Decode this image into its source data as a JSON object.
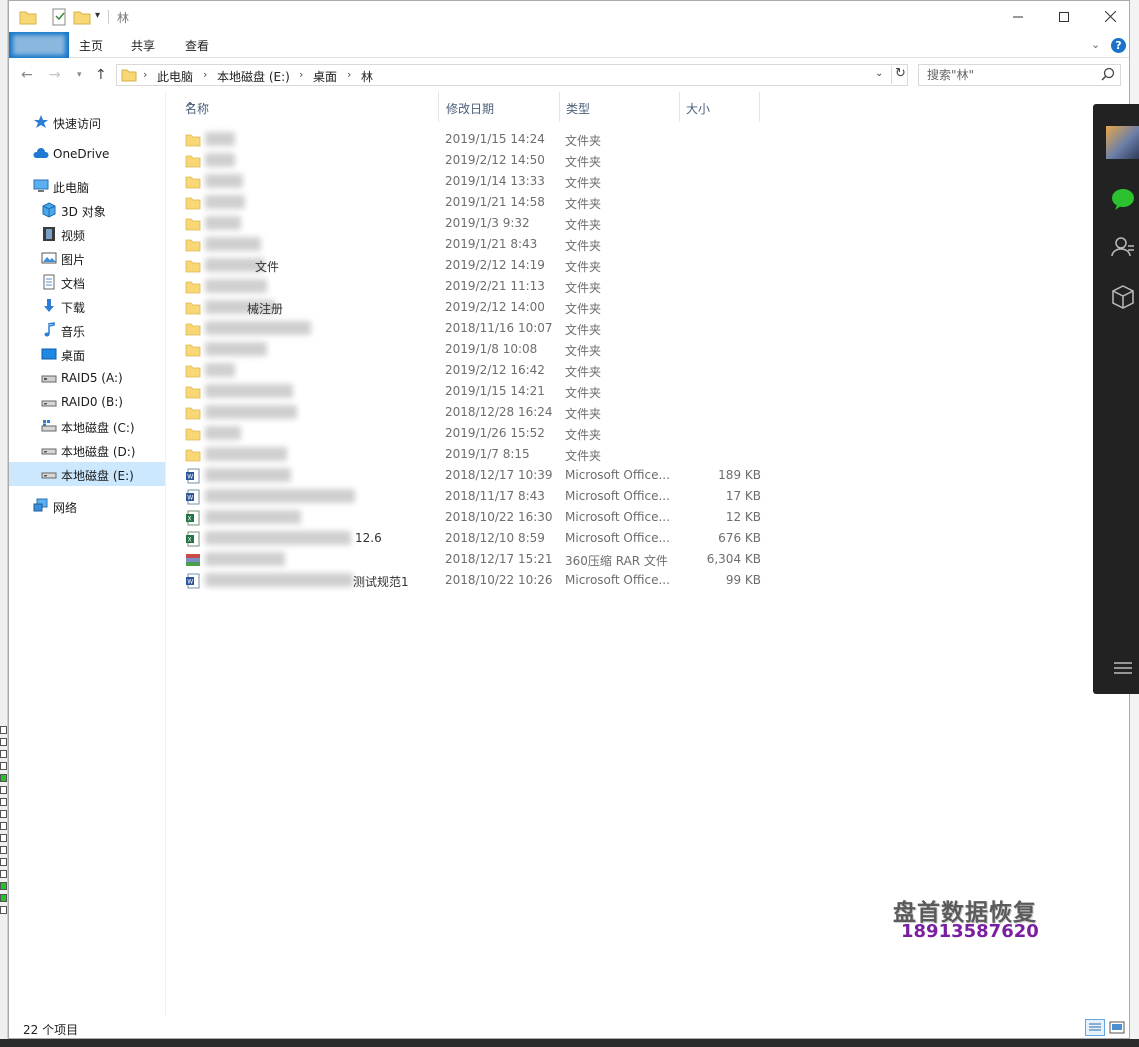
{
  "window": {
    "title": "林",
    "minimize_icon": "minimize-icon",
    "maximize_icon": "maximize-icon",
    "close_icon": "close-icon"
  },
  "ribbon": {
    "tabs": [
      "主页",
      "共享",
      "查看"
    ],
    "help_label": "?"
  },
  "navbar": {
    "breadcrumb": [
      "此电脑",
      "本地磁盘 (E:)",
      "桌面",
      "林"
    ],
    "search_placeholder": "搜索\"林\""
  },
  "navpane": {
    "items": [
      {
        "label": "快速访问",
        "icon": "star-icon"
      },
      {
        "label": "OneDrive",
        "icon": "cloud-icon"
      },
      {
        "label": "此电脑",
        "icon": "computer-icon"
      },
      {
        "label": "3D 对象",
        "icon": "cube-icon"
      },
      {
        "label": "视频",
        "icon": "film-icon"
      },
      {
        "label": "图片",
        "icon": "picture-icon"
      },
      {
        "label": "文档",
        "icon": "document-icon"
      },
      {
        "label": "下载",
        "icon": "download-icon"
      },
      {
        "label": "音乐",
        "icon": "music-icon"
      },
      {
        "label": "桌面",
        "icon": "desktop-icon"
      },
      {
        "label": "RAID5 (A:)",
        "icon": "drive-icon"
      },
      {
        "label": "RAID0 (B:)",
        "icon": "drive-icon"
      },
      {
        "label": "本地磁盘 (C:)",
        "icon": "windows-drive-icon"
      },
      {
        "label": "本地磁盘 (D:)",
        "icon": "drive-icon"
      },
      {
        "label": "本地磁盘 (E:)",
        "icon": "drive-icon"
      },
      {
        "label": "网络",
        "icon": "network-icon"
      }
    ]
  },
  "columns": [
    "名称",
    "修改日期",
    "类型",
    "大小"
  ],
  "files": [
    {
      "name": "",
      "date": "2019/1/15 14:24",
      "type": "文件夹",
      "size": "",
      "icon": "folder-icon"
    },
    {
      "name": "",
      "date": "2019/2/12 14:50",
      "type": "文件夹",
      "size": "",
      "icon": "folder-icon"
    },
    {
      "name": "",
      "date": "2019/1/14 13:33",
      "type": "文件夹",
      "size": "",
      "icon": "folder-icon"
    },
    {
      "name": "",
      "date": "2019/1/21 14:58",
      "type": "文件夹",
      "size": "",
      "icon": "folder-icon"
    },
    {
      "name": "",
      "date": "2019/1/3 9:32",
      "type": "文件夹",
      "size": "",
      "icon": "folder-icon"
    },
    {
      "name": "",
      "date": "2019/1/21 8:43",
      "type": "文件夹",
      "size": "",
      "icon": "folder-icon"
    },
    {
      "name": "文件",
      "date": "2019/2/12 14:19",
      "type": "文件夹",
      "size": "",
      "icon": "folder-icon"
    },
    {
      "name": "",
      "date": "2019/2/21 11:13",
      "type": "文件夹",
      "size": "",
      "icon": "folder-icon"
    },
    {
      "name": "械注册",
      "date": "2019/2/12 14:00",
      "type": "文件夹",
      "size": "",
      "icon": "folder-icon"
    },
    {
      "name": "",
      "date": "2018/11/16 10:07",
      "type": "文件夹",
      "size": "",
      "icon": "folder-icon"
    },
    {
      "name": "",
      "date": "2019/1/8 10:08",
      "type": "文件夹",
      "size": "",
      "icon": "folder-icon"
    },
    {
      "name": "",
      "date": "2019/2/12 16:42",
      "type": "文件夹",
      "size": "",
      "icon": "folder-icon"
    },
    {
      "name": "",
      "date": "2019/1/15 14:21",
      "type": "文件夹",
      "size": "",
      "icon": "folder-icon"
    },
    {
      "name": "",
      "date": "2018/12/28 16:24",
      "type": "文件夹",
      "size": "",
      "icon": "folder-icon"
    },
    {
      "name": "",
      "date": "2019/1/26 15:52",
      "type": "文件夹",
      "size": "",
      "icon": "folder-icon"
    },
    {
      "name": "",
      "date": "2019/1/7 8:15",
      "type": "文件夹",
      "size": "",
      "icon": "folder-icon"
    },
    {
      "name": "",
      "date": "2018/12/17 10:39",
      "type": "Microsoft Office...",
      "size": "189 KB",
      "icon": "word-doc-icon"
    },
    {
      "name": "",
      "date": "2018/11/17 8:43",
      "type": "Microsoft Office...",
      "size": "17 KB",
      "icon": "word-doc-icon"
    },
    {
      "name": "",
      "date": "2018/10/22 16:30",
      "type": "Microsoft Office...",
      "size": "12 KB",
      "icon": "excel-doc-icon"
    },
    {
      "name": "12.6",
      "date": "2018/12/10 8:59",
      "type": "Microsoft Office...",
      "size": "676 KB",
      "icon": "excel-doc-icon"
    },
    {
      "name": "",
      "date": "2018/12/17 15:21",
      "type": "360压缩 RAR 文件",
      "size": "6,304 KB",
      "icon": "rar-archive-icon"
    },
    {
      "name": "测试规范1",
      "date": "2018/10/22 10:26",
      "type": "Microsoft Office...",
      "size": "99 KB",
      "icon": "word-doc-icon"
    }
  ],
  "status": {
    "item_count": "22 个项目"
  },
  "watermark": {
    "title": "盘首数据恢复",
    "phone": "18913587620"
  },
  "colors": {
    "file_tab": "#1979ca",
    "selection": "#cce8ff",
    "folder": "#f8d775",
    "watermark_phone": "#7a1fa0"
  }
}
